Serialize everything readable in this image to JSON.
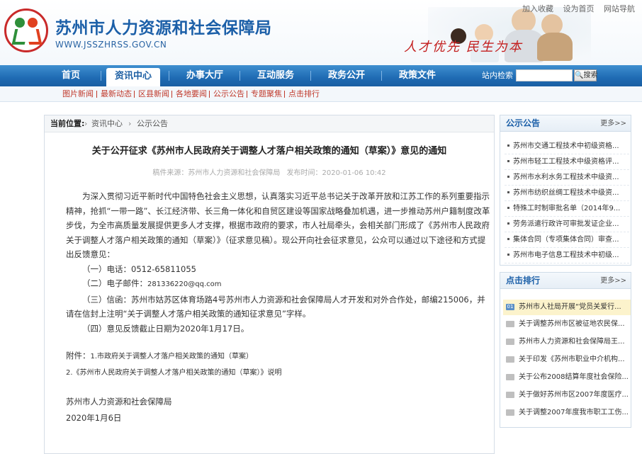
{
  "header": {
    "site_title": "苏州市人力资源和社会保障局",
    "site_url": "WWW.JSSZHRSS.GOV.CN",
    "slogan": "人才优先 民生为本",
    "top_links": [
      "加入收藏",
      "设为首页",
      "网站导航"
    ]
  },
  "nav": {
    "items": [
      "首页",
      "资讯中心",
      "办事大厅",
      "互动服务",
      "政务公开",
      "政策文件"
    ],
    "active_index": 1,
    "search_label": "站内检索",
    "search_value": "",
    "search_button": "搜索"
  },
  "subnav": {
    "items": [
      "图片新闻",
      "最新动态",
      "区县新闻",
      "各地要闻",
      "公示公告",
      "专题聚焦",
      "点击排行"
    ]
  },
  "breadcrumb": {
    "label": "当前位置:",
    "items": [
      "资讯中心",
      "公示公告"
    ],
    "separator": "›"
  },
  "article": {
    "title": "关于公开征求《苏州市人民政府关于调整人才落户相关政策的通知（草案）》意见的通知",
    "source": "稿件来源：苏州市人力资源和社会保障局",
    "date": "发布时间：2020-01-06 10:42",
    "intro": "为深入贯彻习近平新时代中国特色社会主义思想，认真落实习近平总书记关于改革开放和江苏工作的系列重要指示精神，抢抓“一带一路”、长江经济带、长三角一体化和自贸区建设等国家战略叠加机遇，进一步推动苏州户籍制度改革步伐，为全市高质量发展提供更多人才支撑，根据市政府的要求，市人社局牵头，会相关部门形成了《苏州市人民政府关于调整人才落户相关政策的通知（草案）》（征求意见稿）。现公开向社会征求意见，公众可以通过以下途径和方式提出反馈意见：",
    "phone": "（一）电话：0512-65811055",
    "email_label": "（二）电子邮件：",
    "email": "281336220@qq.com",
    "letter": "（三）信函：苏州市姑苏区体育场路4号苏州市人力资源和社会保障局人才开发和对外合作处，邮编215006，并请在信封上注明“关于调整人才落户相关政策的通知征求意见”字样。",
    "deadline": "（四）意见反馈截止日期为2020年1月17日。",
    "attachments_label": "附件：",
    "attachment_1": "1.市政府关于调整人才落户相关政策的通知（草案）",
    "attachment_2": "2.《苏州市人民政府关于调整人才落户相关政策的通知（草案）》说明",
    "signature": "苏州市人力资源和社会保障局",
    "sign_date": "2020年1月6日"
  },
  "notice_panel": {
    "title": "公示公告",
    "more": "更多>>",
    "items": [
      "苏州市交通工程技术中初级资格...",
      "苏州市轻工工程技术中级资格评...",
      "苏州市水利水务工程技术中级资...",
      "苏州市纺织丝绸工程技术中级资...",
      "特殊工时制审批名单（2014年9...",
      "劳务派遣行政许可审批发证企业...",
      "集体合同（专项集体合同）审查...",
      "苏州市电子信息工程技术中初级..."
    ]
  },
  "hot_panel": {
    "title": "点击排行",
    "more": "更多>>",
    "items": [
      "苏州市人社局开展“党员关爱行...",
      "关于调整苏州市区被征地农民保...",
      "苏州市人力资源和社会保障局王...",
      "关于印发《苏州市职业中介机构...",
      "关于公布2008结算年度社会保险...",
      "关于做好苏州市区2007年度医疗...",
      "关于调整2007年度我市职工工伤..."
    ]
  },
  "colors": {
    "brand_blue": "#1b5fa8",
    "nav_blue": "#1f6bb3",
    "subnav_red": "#c0392b",
    "slogan_red": "#c31f1f"
  }
}
